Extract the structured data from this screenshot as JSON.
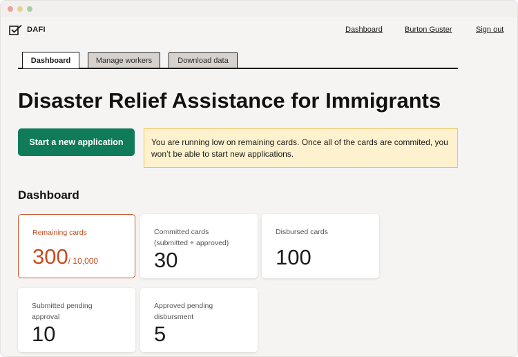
{
  "window": {
    "controls": [
      "close",
      "minimize",
      "maximize"
    ]
  },
  "header": {
    "logo_icon": "checkbox-check-icon",
    "logo_text": "DAFI",
    "nav": {
      "dashboard": "Dashboard",
      "user": "Burton Guster",
      "sign_out": "Sign out"
    }
  },
  "tabs": [
    {
      "label": "Dashboard",
      "active": true
    },
    {
      "label": "Manage workers",
      "active": false
    },
    {
      "label": "Download data",
      "active": false
    }
  ],
  "page": {
    "title": "Disaster Relief Assistance for Immigrants",
    "start_button": "Start a new application",
    "alert": "You are running low on remaining cards. Once all of the cards are commited, you won’t be able to start new applications.",
    "section_title": "Dashboard"
  },
  "cards": {
    "remaining": {
      "label": "Remaining cards",
      "value": "300",
      "of": "/ 10,000"
    },
    "committed": {
      "label": "Committed cards (submitted + approved)",
      "value": "30"
    },
    "disbursed": {
      "label": "Disbursed cards",
      "value": "100"
    },
    "submitted": {
      "label": "Submitted pending approval",
      "value": "10"
    },
    "approved": {
      "label": "Approved pending disbursment",
      "value": "5"
    }
  },
  "colors": {
    "primary_button": "#0f7b58",
    "alert_bg": "#fdf2cd",
    "alert_border": "#f2c14e",
    "warning_text": "#c44d1f"
  }
}
